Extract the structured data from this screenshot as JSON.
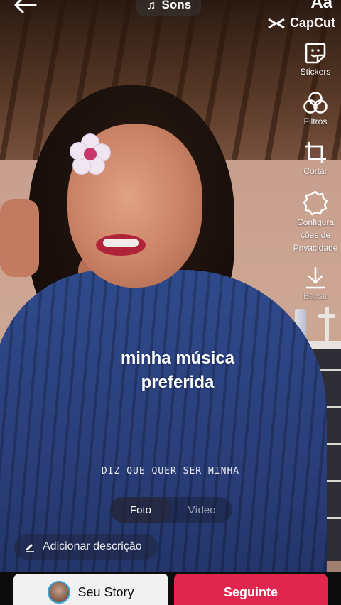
{
  "top": {
    "sounds_label": "Sons",
    "text_tool_label": "Aa",
    "watermark": "CapCut"
  },
  "tools": [
    {
      "icon": "sticker-icon",
      "label": "Stickers"
    },
    {
      "icon": "filters-icon",
      "label": "Filtros"
    },
    {
      "icon": "crop-icon",
      "label": "Cortar"
    },
    {
      "icon": "settings-icon",
      "label": "Configurações de Privacidade",
      "lines": [
        "Configura",
        "ções de",
        "Privacidade"
      ]
    },
    {
      "icon": "download-icon",
      "label": "Baixar"
    }
  ],
  "overlay": {
    "caption_line1": "minha música",
    "caption_line2": "preferida",
    "lyric": "DIZ QUE QUER SER MINHA"
  },
  "mode_switch": {
    "photo": "Foto",
    "video": "Vídeo",
    "selected": "Foto"
  },
  "description_placeholder": "Adicionar descrição",
  "bottom": {
    "story_label": "Seu Story",
    "next_label": "Seguinte"
  },
  "colors": {
    "accent": "#e1264e",
    "story_bg": "#f1f1f1"
  }
}
